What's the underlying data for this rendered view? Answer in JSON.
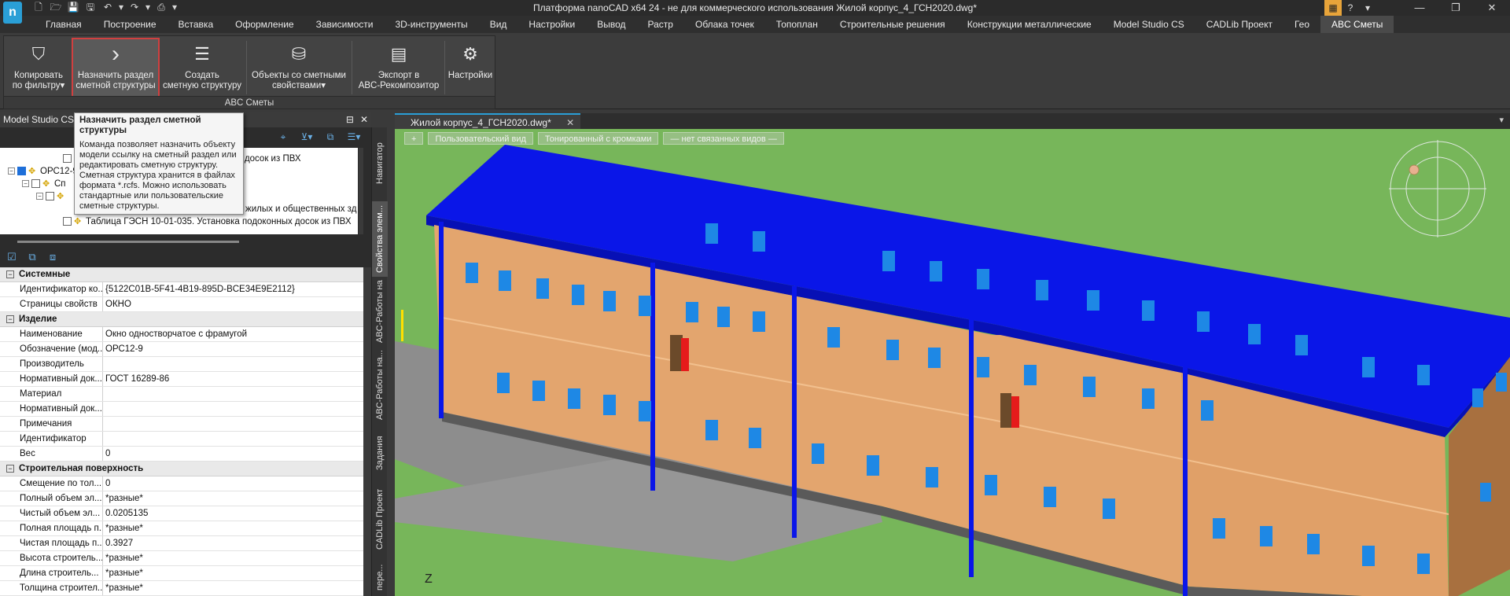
{
  "window": {
    "title": "Платформа nanoCAD x64 24 - не для коммерческого использования Жилой корпус_4_ГСН2020.dwg*",
    "logo_letter": "n",
    "qat_icons": [
      "new-file-icon",
      "open-folder-icon",
      "save-icon",
      "save-as-icon",
      "undo-icon",
      "undo-dropdown-icon",
      "redo-icon",
      "redo-dropdown-icon",
      "print-icon",
      "qat-more-icon"
    ],
    "controls": {
      "minimize": "—",
      "maximize": "❐",
      "close": "✕"
    },
    "right_icons": {
      "app": "▦",
      "help": "?",
      "dropdown": "▾"
    }
  },
  "ribbon": {
    "tabs": [
      "Главная",
      "Построение",
      "Вставка",
      "Оформление",
      "Зависимости",
      "3D-инструменты",
      "Вид",
      "Настройки",
      "Вывод",
      "Растр",
      "Облака точек",
      "Топоплан",
      "Строительные решения",
      "Конструкции металлические",
      "Model Studio CS",
      "CADLib Проект",
      "Гео",
      "ABC Сметы"
    ],
    "active_tab": "ABC Сметы",
    "group_label": "ABC Сметы",
    "buttons": [
      {
        "line1": "Копировать",
        "line2": "по фильтру▾",
        "icon": "copy-filter-icon",
        "glyph": "⛉"
      },
      {
        "line1": "Назначить раздел",
        "line2": "сметной структуры",
        "icon": "chevron-right-icon",
        "glyph": "›"
      },
      {
        "line1": "Создать",
        "line2": "сметную структуру",
        "icon": "create-structure-icon",
        "glyph": "☰"
      },
      {
        "line1": "Объекты со сметными",
        "line2": "свойствами▾",
        "icon": "objects-estimate-icon",
        "glyph": "⛁"
      },
      {
        "line1": "Экспорт в",
        "line2": "ABC-Рекомпозитор",
        "icon": "export-icon",
        "glyph": "▤"
      },
      {
        "line1": "Настройки",
        "line2": "",
        "icon": "gear-icon",
        "glyph": "⚙"
      }
    ]
  },
  "tooltip": {
    "title": "Назначить раздел сметной структуры",
    "body": "Команда позволяет назначить объекту модели ссылку на сметный раздел или редактировать сметную структуру. Сметная структура хранится в файлах формата *.rcfs. Можно использовать стандартные или пользовательские сметные структуры."
  },
  "left_panel": {
    "title": "Model Studio CS",
    "header_icons": {
      "pin": "⊟",
      "close": "✕"
    },
    "tool_glyphs": [
      "⌖",
      "⊻▾",
      "⧉",
      "☰▾"
    ],
    "tree": [
      {
        "text": "подоконных досок из ПВХ",
        "checked": false
      },
      {
        "text": "ОРС12-9",
        "checked": true
      },
      {
        "text": "Сп",
        "checked": false
      },
      {
        "text": "",
        "checked": false
      },
      {
        "text": "жилых и общественных зд",
        "checked": false
      },
      {
        "text": "Таблица ГЭСН 10-01-035. Установка подоконных досок из ПВХ",
        "checked": false
      }
    ],
    "tree_tool_glyphs": [
      "☑",
      "⧉",
      "⧈"
    ]
  },
  "properties": {
    "sections": [
      {
        "title": "Системные",
        "rows": [
          {
            "name": "Идентификатор ко...",
            "value": "{5122C01B-5F41-4B19-895D-BCE34E9E2112}"
          },
          {
            "name": "Страницы свойств",
            "value": "ОКНО"
          }
        ]
      },
      {
        "title": "Изделие",
        "rows": [
          {
            "name": "Наименование",
            "value": "Окно одностворчатое с фрамугой"
          },
          {
            "name": "Обозначение (мод...",
            "value": "ОРС12-9"
          },
          {
            "name": "Производитель",
            "value": ""
          },
          {
            "name": "Нормативный док...",
            "value": "ГОСТ 16289-86"
          },
          {
            "name": "Материал",
            "value": ""
          },
          {
            "name": "Нормативный док...",
            "value": ""
          },
          {
            "name": "Примечания",
            "value": ""
          },
          {
            "name": "Идентификатор",
            "value": ""
          },
          {
            "name": "Вес",
            "value": "0"
          }
        ]
      },
      {
        "title": "Строительная поверхность",
        "rows": [
          {
            "name": "Смещение по тол...",
            "value": "0"
          },
          {
            "name": "Полный объем эл...",
            "value": "*разные*"
          },
          {
            "name": "Чистый объем эл...",
            "value": "0.0205135"
          },
          {
            "name": "Полная площадь п...",
            "value": "*разные*"
          },
          {
            "name": "Чистая площадь п...",
            "value": "0.3927"
          },
          {
            "name": "Высота строитель...",
            "value": "*разные*"
          },
          {
            "name": "Длина строитель...",
            "value": "*разные*"
          },
          {
            "name": "Толщина строител...",
            "value": "*разные*"
          }
        ]
      }
    ]
  },
  "side_tabs": [
    "Навигатор",
    "Свойства элем...",
    "ABC-Работы на",
    "ABC-Работы на...",
    "Задания",
    "CADLib Проект",
    "пере..."
  ],
  "document": {
    "tab_title": "Жилой корпус_4_ГСН2020.dwg*",
    "close": "✕",
    "menu": "▾",
    "viewport_buttons": [
      "+",
      "Пользовательский вид",
      "Тонированный с кромками",
      "— нет связанных видов —"
    ],
    "axis_label": "Z"
  },
  "colors": {
    "roof": "#0a16e8",
    "wall": "#e3a56e",
    "ground": "#77b65a",
    "window": "#1e88e5",
    "highlight": "#d04040"
  }
}
